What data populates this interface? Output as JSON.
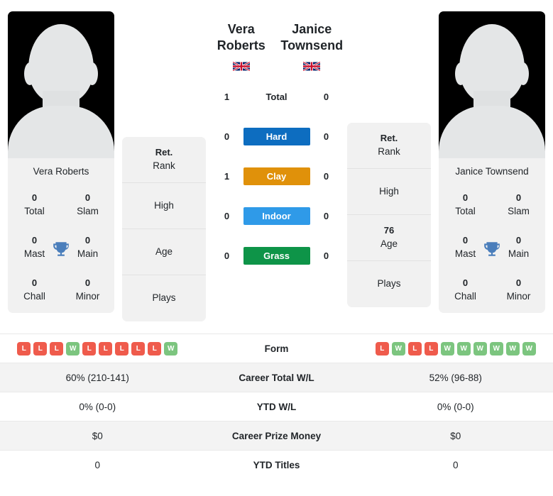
{
  "colors": {
    "hard": "#0d6dc0",
    "clay": "#e0910a",
    "indoor": "#2f9ae8",
    "grass": "#0e9448",
    "win": "#7cc57f",
    "loss": "#ef5b4c",
    "trophy": "#4a7ebb",
    "card_bg": "#f1f1f1",
    "row_alt": "#f3f3f3"
  },
  "players": {
    "left": {
      "name": "Vera Roberts",
      "card_name": "Vera Roberts",
      "flag": "gb-flag-icon",
      "flag_label": "United Kingdom",
      "titles": [
        {
          "value": "0",
          "label": "Total"
        },
        {
          "value": "0",
          "label": "Slam"
        },
        {
          "value": "0",
          "label": "Mast"
        },
        {
          "value": "0",
          "label": "Main"
        },
        {
          "value": "0",
          "label": "Chall"
        },
        {
          "value": "0",
          "label": "Minor"
        }
      ],
      "info": [
        {
          "value": "Ret.",
          "label": "Rank"
        },
        {
          "value": "",
          "label": "High"
        },
        {
          "value": "",
          "label": "Age"
        },
        {
          "value": "",
          "label": "Plays"
        }
      ],
      "form": [
        "L",
        "L",
        "L",
        "W",
        "L",
        "L",
        "L",
        "L",
        "L",
        "W"
      ],
      "career_total_wl": "60% (210-141)",
      "ytd_wl": "0% (0-0)",
      "career_prize_money": "$0",
      "ytd_titles": "0"
    },
    "right": {
      "name": "Janice Townsend",
      "card_name": "Janice Townsend",
      "flag": "gb-flag-icon",
      "flag_label": "United Kingdom",
      "titles": [
        {
          "value": "0",
          "label": "Total"
        },
        {
          "value": "0",
          "label": "Slam"
        },
        {
          "value": "0",
          "label": "Mast"
        },
        {
          "value": "0",
          "label": "Main"
        },
        {
          "value": "0",
          "label": "Chall"
        },
        {
          "value": "0",
          "label": "Minor"
        }
      ],
      "info": [
        {
          "value": "Ret.",
          "label": "Rank"
        },
        {
          "value": "",
          "label": "High"
        },
        {
          "value": "76",
          "label": "Age"
        },
        {
          "value": "",
          "label": "Plays"
        }
      ],
      "form": [
        "L",
        "W",
        "L",
        "L",
        "W",
        "W",
        "W",
        "W",
        "W",
        "W"
      ],
      "career_total_wl": "52% (96-88)",
      "ytd_wl": "0% (0-0)",
      "career_prize_money": "$0",
      "ytd_titles": "0"
    }
  },
  "surfaces": [
    {
      "label": "Total",
      "left": "1",
      "right": "0",
      "color": "none",
      "plain": true
    },
    {
      "label": "Hard",
      "left": "0",
      "right": "0",
      "color": "#0d6dc0",
      "plain": false
    },
    {
      "label": "Clay",
      "left": "1",
      "right": "0",
      "color": "#e0910a",
      "plain": false
    },
    {
      "label": "Indoor",
      "left": "0",
      "right": "0",
      "color": "#2f9ae8",
      "plain": false
    },
    {
      "label": "Grass",
      "left": "0",
      "right": "0",
      "color": "#0e9448",
      "plain": false
    }
  ],
  "table": {
    "rows": [
      {
        "label": "Form",
        "key": "form",
        "type": "form"
      },
      {
        "label": "Career Total W/L",
        "key": "career_total_wl",
        "type": "text"
      },
      {
        "label": "YTD W/L",
        "key": "ytd_wl",
        "type": "text"
      },
      {
        "label": "Career Prize Money",
        "key": "career_prize_money",
        "type": "text"
      },
      {
        "label": "YTD Titles",
        "key": "ytd_titles",
        "type": "text"
      }
    ]
  }
}
